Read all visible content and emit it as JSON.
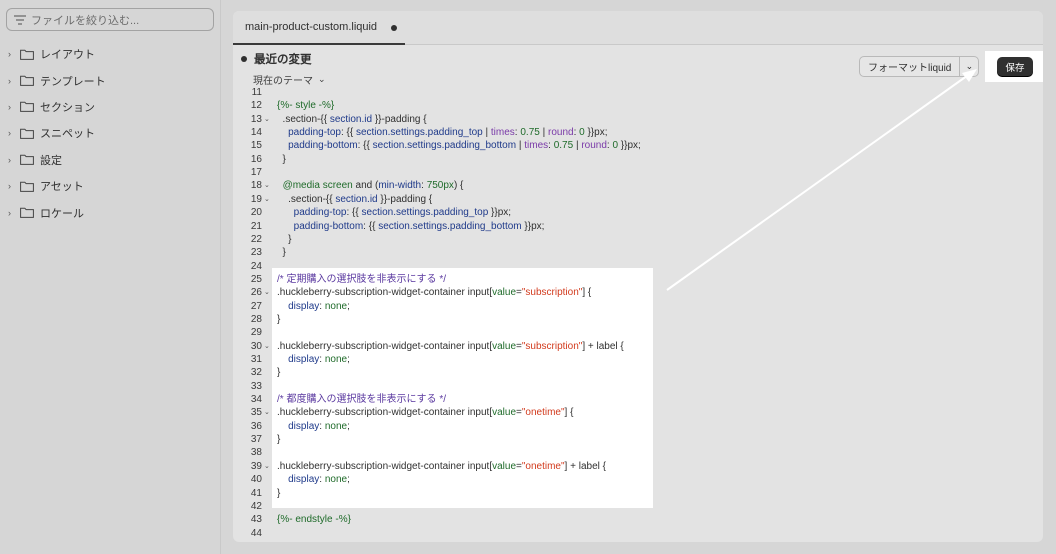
{
  "sidebar": {
    "search_placeholder": "ファイルを絞り込む...",
    "items": [
      {
        "label": "レイアウト"
      },
      {
        "label": "テンプレート"
      },
      {
        "label": "セクション"
      },
      {
        "label": "スニペット"
      },
      {
        "label": "設定"
      },
      {
        "label": "アセット"
      },
      {
        "label": "ロケール"
      }
    ]
  },
  "editor": {
    "tab_label": "main-product-custom.liquid",
    "recent_changes_title": "最近の変更",
    "current_theme_label": "現在のテーマ",
    "format_label": "フォーマットliquid",
    "save_label": "保存"
  },
  "code_lines": [
    {
      "n": "11",
      "fold": false,
      "t": ""
    },
    {
      "n": "12",
      "fold": false,
      "t": "{%- style -%}"
    },
    {
      "n": "13",
      "fold": true,
      "t": "  .section-{{ section.id }}-padding {"
    },
    {
      "n": "14",
      "fold": false,
      "t": "    padding-top: {{ section.settings.padding_top | times: 0.75 | round: 0 }}px;"
    },
    {
      "n": "15",
      "fold": false,
      "t": "    padding-bottom: {{ section.settings.padding_bottom | times: 0.75 | round: 0 }}px;"
    },
    {
      "n": "16",
      "fold": false,
      "t": "  }"
    },
    {
      "n": "17",
      "fold": false,
      "t": ""
    },
    {
      "n": "18",
      "fold": true,
      "t": "  @media screen and (min-width: 750px) {"
    },
    {
      "n": "19",
      "fold": true,
      "t": "    .section-{{ section.id }}-padding {"
    },
    {
      "n": "20",
      "fold": false,
      "t": "      padding-top: {{ section.settings.padding_top }}px;"
    },
    {
      "n": "21",
      "fold": false,
      "t": "      padding-bottom: {{ section.settings.padding_bottom }}px;"
    },
    {
      "n": "22",
      "fold": false,
      "t": "    }"
    },
    {
      "n": "23",
      "fold": false,
      "t": "  }"
    },
    {
      "n": "24",
      "fold": false,
      "t": ""
    },
    {
      "n": "25",
      "fold": false,
      "t": "/* 定期購入の選択肢を非表示にする */"
    },
    {
      "n": "26",
      "fold": true,
      "t": ".huckleberry-subscription-widget-container input[value=\"subscription\"] {"
    },
    {
      "n": "27",
      "fold": false,
      "t": "    display: none;"
    },
    {
      "n": "28",
      "fold": false,
      "t": "}"
    },
    {
      "n": "29",
      "fold": false,
      "t": ""
    },
    {
      "n": "30",
      "fold": true,
      "t": ".huckleberry-subscription-widget-container input[value=\"subscription\"] + label {"
    },
    {
      "n": "31",
      "fold": false,
      "t": "    display: none;"
    },
    {
      "n": "32",
      "fold": false,
      "t": "}"
    },
    {
      "n": "33",
      "fold": false,
      "t": ""
    },
    {
      "n": "34",
      "fold": false,
      "t": "/* 都度購入の選択肢を非表示にする */"
    },
    {
      "n": "35",
      "fold": true,
      "t": ".huckleberry-subscription-widget-container input[value=\"onetime\"] {"
    },
    {
      "n": "36",
      "fold": false,
      "t": "    display: none;"
    },
    {
      "n": "37",
      "fold": false,
      "t": "}"
    },
    {
      "n": "38",
      "fold": false,
      "t": ""
    },
    {
      "n": "39",
      "fold": true,
      "t": ".huckleberry-subscription-widget-container input[value=\"onetime\"] + label {"
    },
    {
      "n": "40",
      "fold": false,
      "t": "    display: none;"
    },
    {
      "n": "41",
      "fold": false,
      "t": "}"
    },
    {
      "n": "42",
      "fold": false,
      "t": ""
    },
    {
      "n": "43",
      "fold": false,
      "t": "{%- endstyle -%}"
    },
    {
      "n": "44",
      "fold": false,
      "t": ""
    }
  ],
  "icons": {
    "search": "filter-icon",
    "folder": "folder-icon",
    "chevron_right": "chevron-right-icon",
    "chevron_down": "chevron-down-icon"
  },
  "colors": {
    "save_button": "#303030",
    "highlight": "#ffffff",
    "arrow": "#ffffff"
  }
}
